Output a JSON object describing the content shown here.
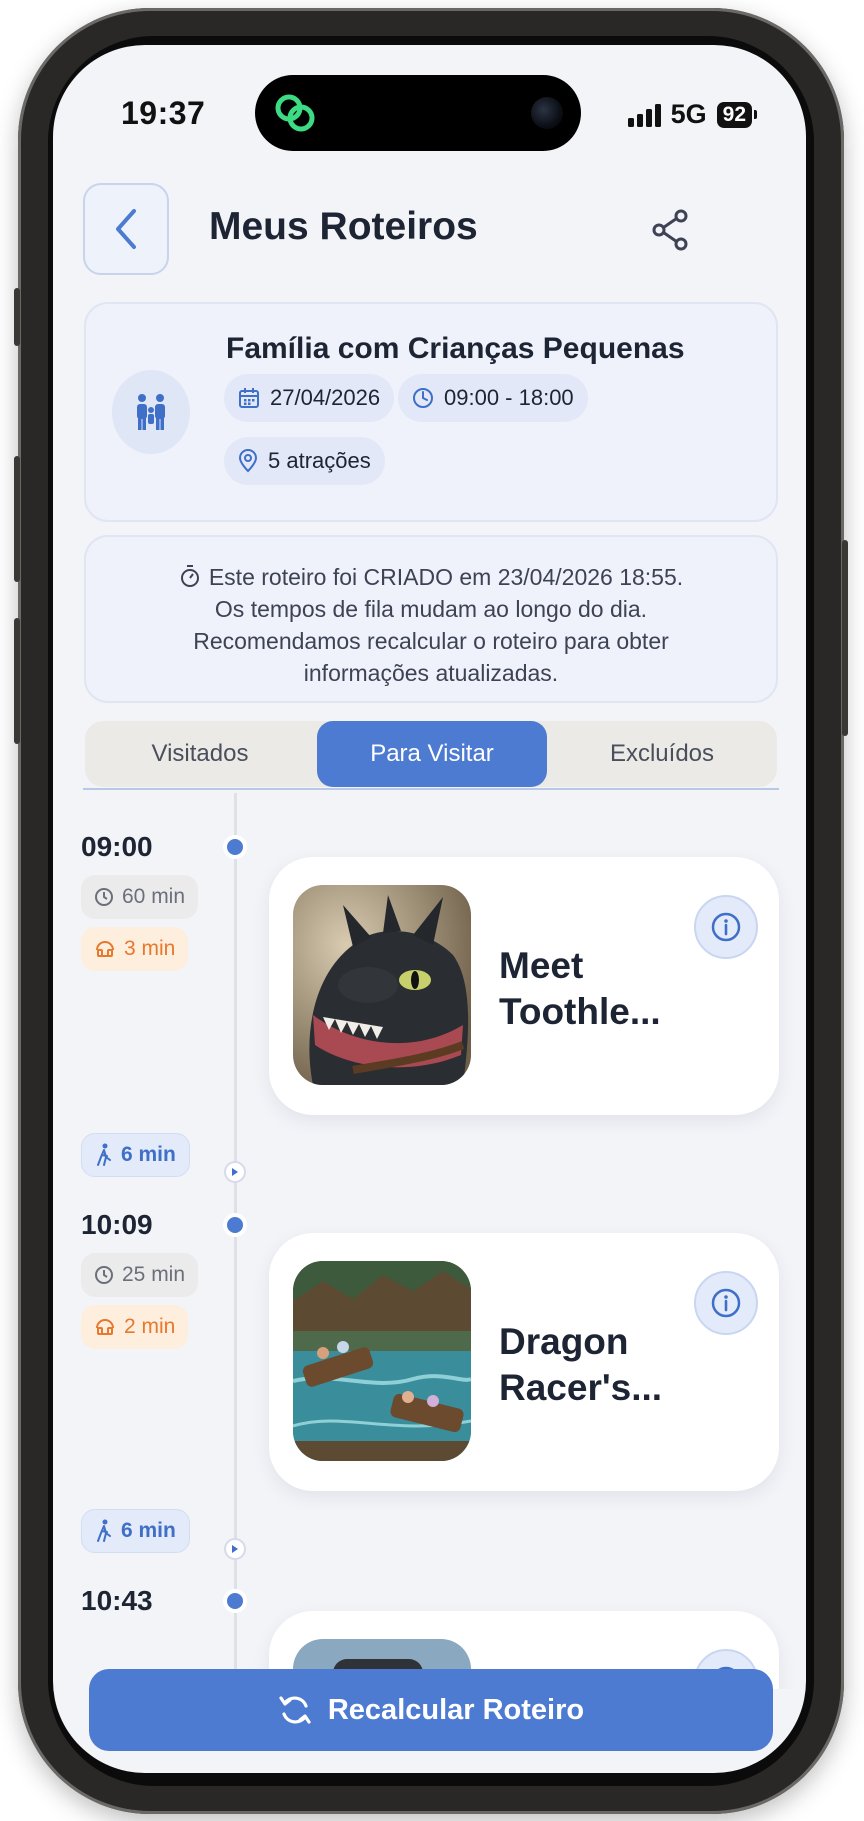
{
  "status_bar": {
    "time": "19:37",
    "network": "5G",
    "battery": "92"
  },
  "header": {
    "title": "Meus Roteiros"
  },
  "profile": {
    "name": "Família com Crianças Pequenas",
    "date": "27/04/2026",
    "hours": "09:00 - 18:00",
    "attractions": "5 atrações"
  },
  "notice": {
    "line1": "Este roteiro foi CRIADO em 23/04/2026 18:55.",
    "line2": "Os tempos de fila mudam ao longo do dia.",
    "line3": "Recomendamos recalcular o roteiro para obter",
    "line4": "informações atualizadas."
  },
  "tabs": [
    {
      "label": "Visitados",
      "active": false
    },
    {
      "label": "Para Visitar",
      "active": true
    },
    {
      "label": "Excluídos",
      "active": false
    }
  ],
  "timeline": [
    {
      "time": "09:00",
      "duration": "60 min",
      "wait": "3 min",
      "walk": "6 min",
      "name": "Meet Toothle...",
      "image": "dragon-character-photo"
    },
    {
      "time": "10:09",
      "duration": "25 min",
      "wait": "2 min",
      "walk": "6 min",
      "name": "Dragon Racer's...",
      "image": "ride-boats-photo"
    },
    {
      "time": "10:43",
      "name": "",
      "image": "castle-photo"
    }
  ],
  "footer": {
    "recalc_label": "Recalcular Roteiro"
  },
  "colors": {
    "accent": "#4d7bd2",
    "wait": "#e8782d",
    "background": "#f3f4f8"
  }
}
